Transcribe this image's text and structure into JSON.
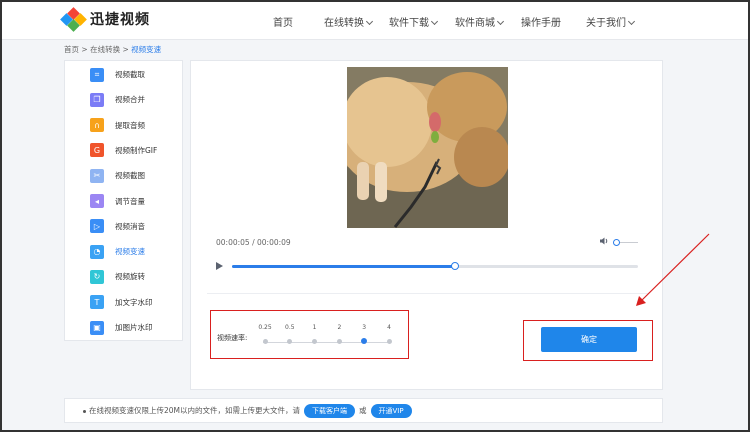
{
  "header": {
    "logo_title": "迅捷视频",
    "nav": [
      {
        "label": "首页",
        "dropdown": false
      },
      {
        "label": "在线转换",
        "dropdown": true
      },
      {
        "label": "软件下载",
        "dropdown": true
      },
      {
        "label": "软件商城",
        "dropdown": true
      },
      {
        "label": "操作手册",
        "dropdown": false
      },
      {
        "label": "关于我们",
        "dropdown": true
      }
    ]
  },
  "breadcrumb": {
    "home": "首页",
    "sep1": ">",
    "section": "在线转换",
    "sep2": ">",
    "current": "视频变速"
  },
  "sidebar": {
    "items": [
      {
        "label": "视频截取",
        "icon": "crop-icon",
        "color": "#3a8ef6"
      },
      {
        "label": "视频合并",
        "icon": "merge-icon",
        "color": "#7b7cf6"
      },
      {
        "label": "提取音频",
        "icon": "headphones-icon",
        "color": "#f7a21b"
      },
      {
        "label": "视频制作GIF",
        "icon": "gif-icon",
        "color": "#f0542b"
      },
      {
        "label": "视频截图",
        "icon": "scissors-icon",
        "color": "#8fb4f2"
      },
      {
        "label": "调节音量",
        "icon": "volume-icon",
        "color": "#9b86f3"
      },
      {
        "label": "视频消音",
        "icon": "mute-icon",
        "color": "#3a8ef6"
      },
      {
        "label": "视频变速",
        "icon": "speed-icon",
        "color": "#3aa2f4"
      },
      {
        "label": "视频旋转",
        "icon": "rotate-icon",
        "color": "#30c6d6"
      },
      {
        "label": "加文字水印",
        "icon": "text-watermark-icon",
        "color": "#3aa2f4"
      },
      {
        "label": "加图片水印",
        "icon": "image-watermark-icon",
        "color": "#3a8ef6"
      }
    ],
    "active_index": 7
  },
  "player": {
    "current_time": "00:00:05",
    "separator": "/",
    "duration": "00:00:09",
    "progress": 0.55,
    "volume": 0.1
  },
  "speed": {
    "label": "视频速率:",
    "options": [
      "0.25",
      "0.5",
      "1",
      "2",
      "3",
      "4"
    ],
    "selected_index": 4
  },
  "confirm": {
    "label": "确定"
  },
  "notice": {
    "text_before": "在线视频变速仅限上传20M以内的文件，如需上传更大文件，请",
    "download_label": "下载客户端",
    "or": "或",
    "vip_label": "开通VIP"
  },
  "colors": {
    "accent": "#1f86ea",
    "highlight_box": "#d9201f"
  }
}
